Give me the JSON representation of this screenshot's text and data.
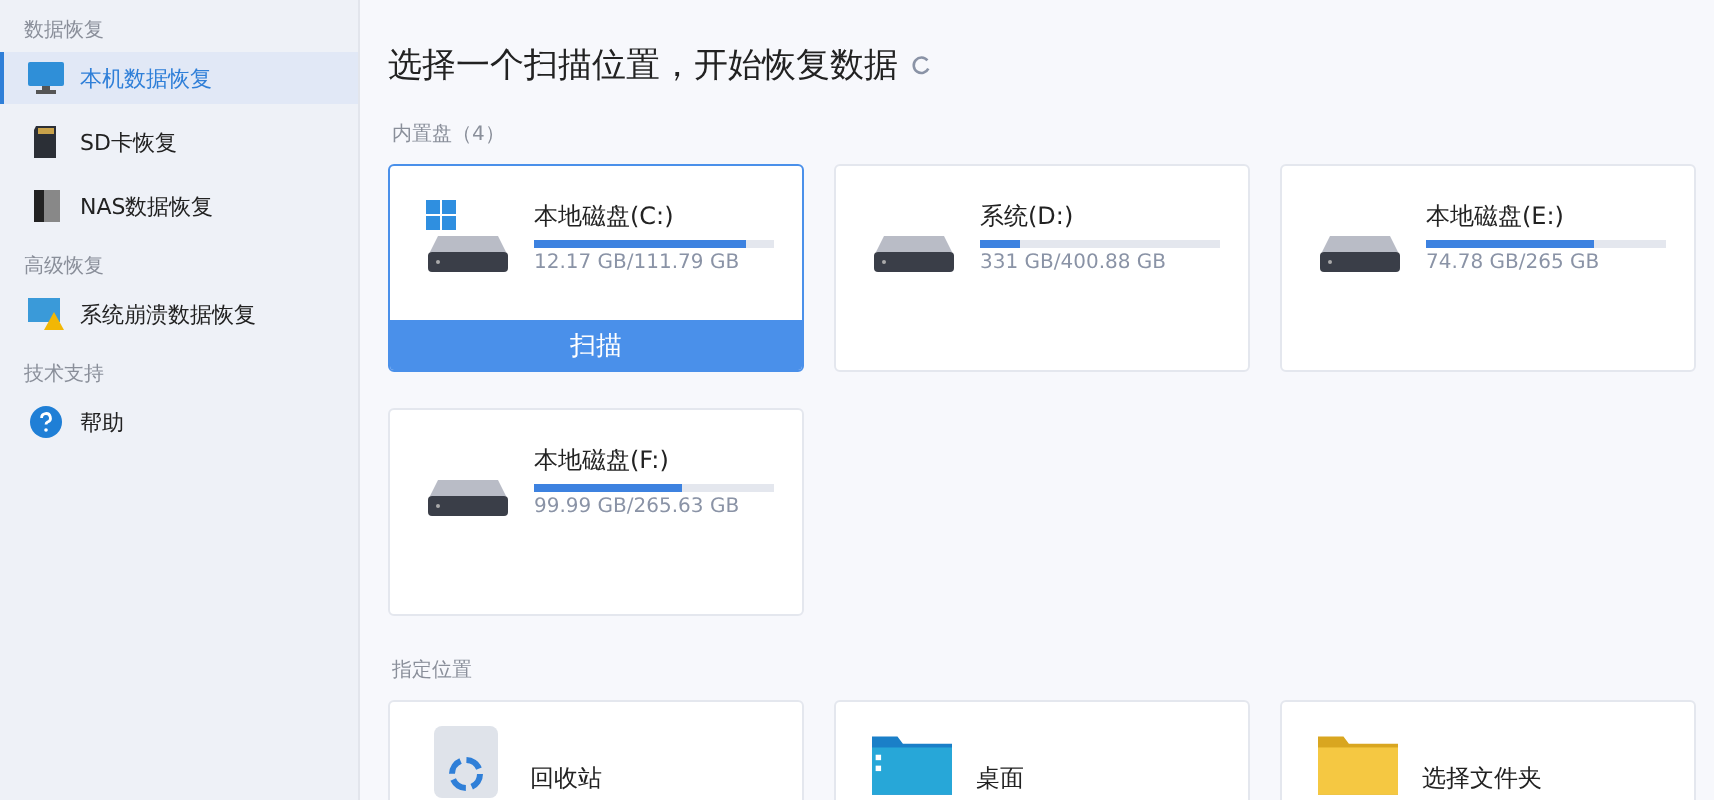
{
  "sidebar": {
    "sections": [
      {
        "heading": "数据恢复",
        "items": [
          {
            "label": "本机数据恢复",
            "kind": "monitor",
            "selected": true
          },
          {
            "label": "SD卡恢复",
            "kind": "sdcard",
            "selected": false
          },
          {
            "label": "NAS数据恢复",
            "kind": "nas",
            "selected": false
          }
        ]
      },
      {
        "heading": "高级恢复",
        "items": [
          {
            "label": "系统崩溃数据恢复",
            "kind": "crash",
            "selected": false
          }
        ]
      },
      {
        "heading": "技术支持",
        "items": [
          {
            "label": "帮助",
            "kind": "help",
            "selected": false
          }
        ]
      }
    ]
  },
  "title": "选择一个扫描位置，开始恢复数据",
  "drives": {
    "heading": "内置盘（4）",
    "scan_label": "扫描",
    "items": [
      {
        "name": "本地磁盘(C:)",
        "usage": "12.17 GB/111.79 GB",
        "level": 0.88,
        "system": true,
        "selected": true
      },
      {
        "name": "系统(D:)",
        "usage": "331 GB/400.88 GB",
        "level": 0.17,
        "system": false,
        "selected": false
      },
      {
        "name": "本地磁盘(E:)",
        "usage": "74.78 GB/265 GB",
        "level": 0.7,
        "system": false,
        "selected": false
      },
      {
        "name": "本地磁盘(F:)",
        "usage": "99.99 GB/265.63 GB",
        "level": 0.62,
        "system": false,
        "selected": false
      }
    ]
  },
  "locations": {
    "heading": "指定位置",
    "items": [
      {
        "name": "回收站",
        "kind": "recycle"
      },
      {
        "name": "桌面",
        "kind": "desktop"
      },
      {
        "name": "选择文件夹",
        "kind": "folder"
      }
    ]
  }
}
